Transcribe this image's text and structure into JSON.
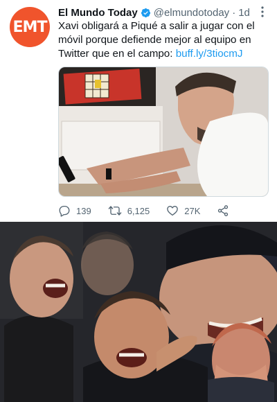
{
  "tweet": {
    "avatar_text": "EMT",
    "name": "El Mundo Today",
    "handle": "@elmundotoday",
    "separator": "·",
    "time": "1d",
    "text_before_link": "Xavi obligará a Piqué a salir a jugar con el móvil porque defiende mejor al equipo en Twitter que en el campo: ",
    "link": "buff.ly/3tiocmJ",
    "replies": "139",
    "retweets": "6,125",
    "likes": "27K"
  },
  "colors": {
    "brand": "#f0542c",
    "link": "#1d9bf0",
    "verified": "#1d9bf0",
    "secondary_text": "#536471"
  },
  "icons": [
    "verified-icon",
    "more-icon",
    "reply-icon",
    "retweet-icon",
    "like-icon",
    "share-icon"
  ]
}
